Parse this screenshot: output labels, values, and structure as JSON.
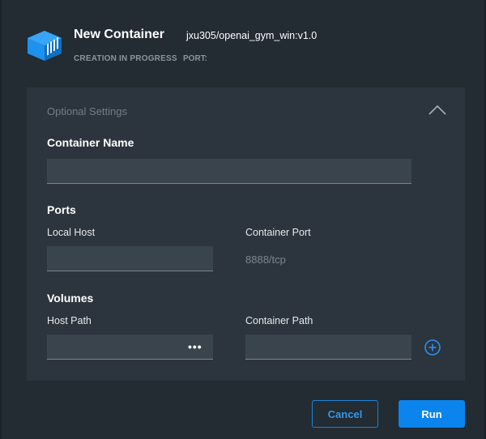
{
  "header": {
    "title": "New Container",
    "image_name": "jxu305/openai_gym_win:v1.0",
    "status": "CREATION IN PROGRESS",
    "port_label": "PORT:"
  },
  "optional_settings": {
    "title": "Optional Settings",
    "collapse_icon": "chevron-up-icon"
  },
  "container_name": {
    "label": "Container Name",
    "value": ""
  },
  "ports": {
    "label": "Ports",
    "local_host_label": "Local Host",
    "local_host_value": "",
    "container_port_label": "Container Port",
    "container_port_value": "8888/tcp"
  },
  "volumes": {
    "label": "Volumes",
    "host_path_label": "Host Path",
    "host_path_value": "",
    "browse_label": "•••",
    "container_path_label": "Container Path",
    "container_path_value": "",
    "add_icon": "plus-circle-icon"
  },
  "actions": {
    "cancel_label": "Cancel",
    "run_label": "Run"
  },
  "colors": {
    "background": "#232b33",
    "panel": "#2c353d",
    "field": "#3a444c",
    "accent": "#0b84ee",
    "logo": "#1d91ee"
  }
}
